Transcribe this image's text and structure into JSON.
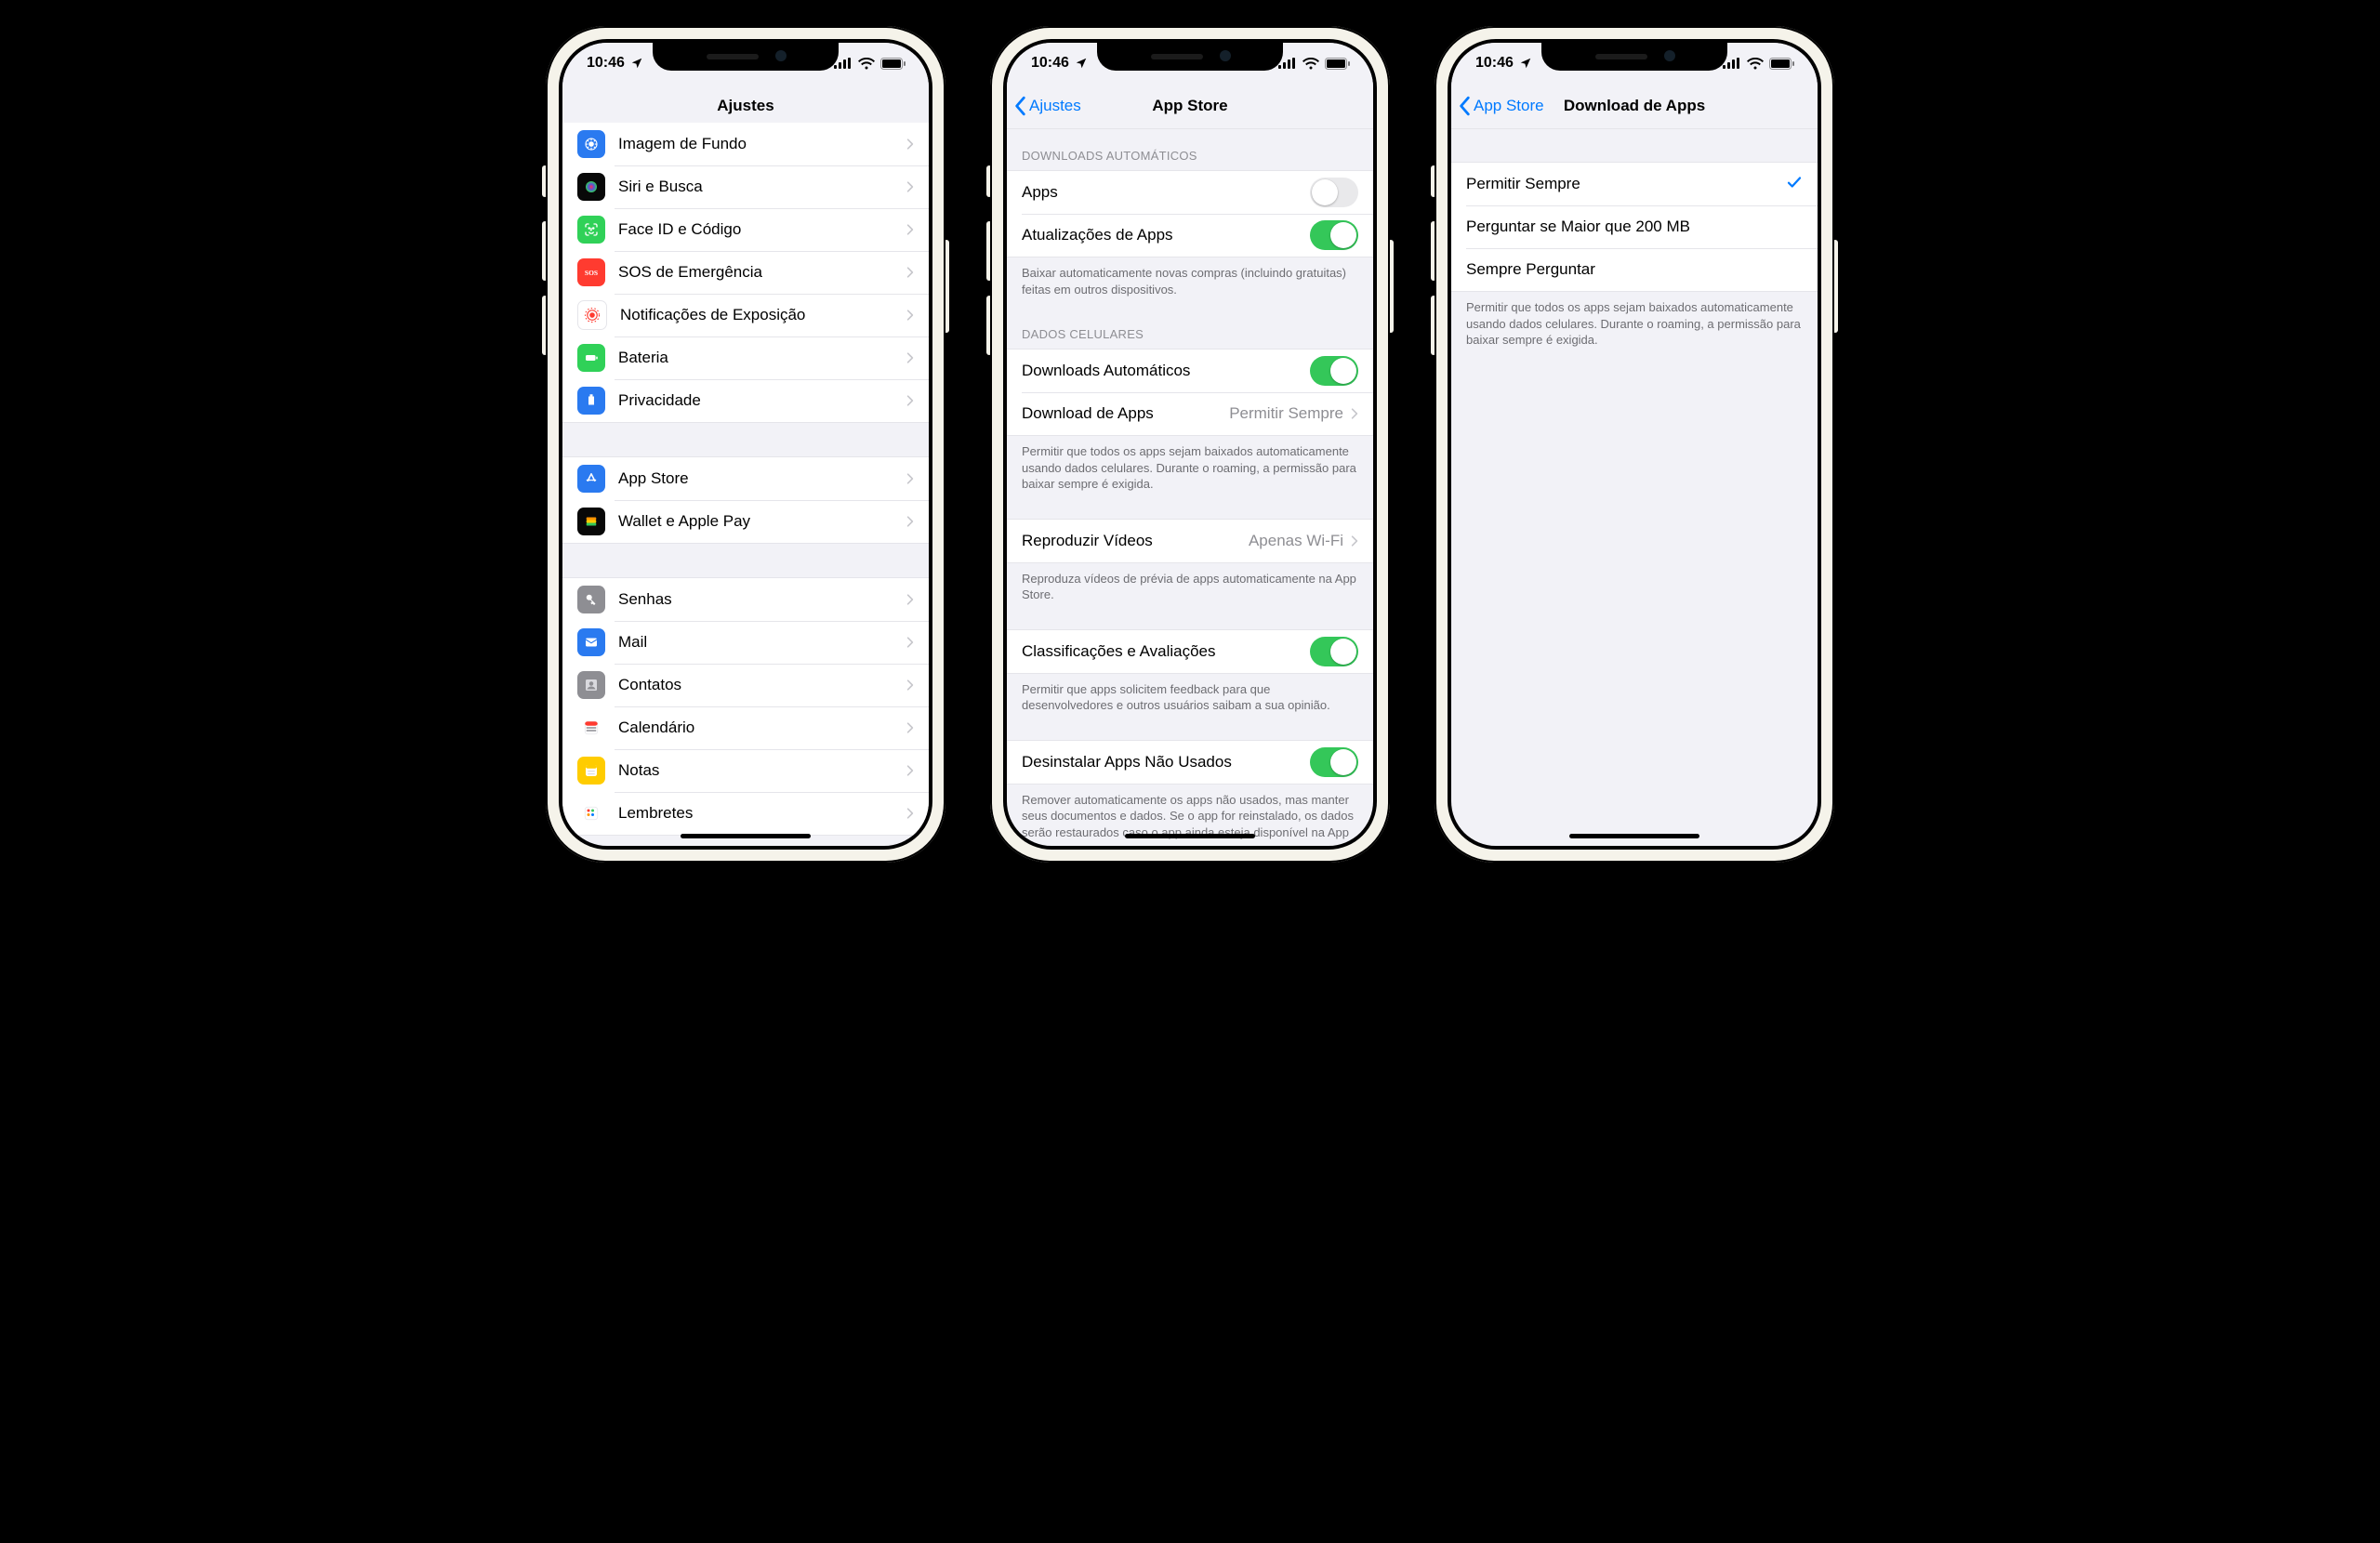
{
  "status": {
    "time": "10:46"
  },
  "phone1": {
    "title": "Ajustes",
    "groups": [
      {
        "items": [
          {
            "label": "Imagem de Fundo",
            "icon": "wallpaper"
          },
          {
            "label": "Siri e Busca",
            "icon": "siri"
          },
          {
            "label": "Face ID e Código",
            "icon": "faceid"
          },
          {
            "label": "SOS de Emergência",
            "icon": "sos"
          },
          {
            "label": "Notificações de Exposição",
            "icon": "exposure"
          },
          {
            "label": "Bateria",
            "icon": "battery"
          },
          {
            "label": "Privacidade",
            "icon": "privacy"
          }
        ]
      },
      {
        "items": [
          {
            "label": "App Store",
            "icon": "appstore"
          },
          {
            "label": "Wallet e Apple Pay",
            "icon": "wallet"
          }
        ]
      },
      {
        "items": [
          {
            "label": "Senhas",
            "icon": "passwords"
          },
          {
            "label": "Mail",
            "icon": "mail"
          },
          {
            "label": "Contatos",
            "icon": "contacts"
          },
          {
            "label": "Calendário",
            "icon": "calendar"
          },
          {
            "label": "Notas",
            "icon": "notes"
          },
          {
            "label": "Lembretes",
            "icon": "reminders"
          }
        ]
      }
    ]
  },
  "phone2": {
    "back": "Ajustes",
    "title": "App Store",
    "sections": [
      {
        "header": "DOWNLOADS AUTOMÁTICOS",
        "rows": [
          {
            "label": "Apps",
            "toggle": false
          },
          {
            "label": "Atualizações de Apps",
            "toggle": true
          }
        ],
        "footer": "Baixar automaticamente novas compras (incluindo gratuitas) feitas em outros dispositivos."
      },
      {
        "header": "DADOS CELULARES",
        "rows": [
          {
            "label": "Downloads Automáticos",
            "toggle": true
          },
          {
            "label": "Download de Apps",
            "detail": "Permitir Sempre",
            "nav": true
          }
        ],
        "footer": "Permitir que todos os apps sejam baixados automaticamente usando dados celulares. Durante o roaming, a permissão para baixar sempre é exigida."
      },
      {
        "rows": [
          {
            "label": "Reproduzir Vídeos",
            "detail": "Apenas Wi-Fi",
            "nav": true
          }
        ],
        "footer": "Reproduza vídeos de prévia de apps automaticamente na App Store."
      },
      {
        "rows": [
          {
            "label": "Classificações e Avaliações",
            "toggle": true
          }
        ],
        "footer": "Permitir que apps solicitem feedback para que desenvolvedores e outros usuários saibam a sua opinião."
      },
      {
        "rows": [
          {
            "label": "Desinstalar Apps Não Usados",
            "toggle": true
          }
        ],
        "footer": "Remover automaticamente os apps não usados, mas manter seus documentos e dados. Se o app for reinstalado, os dados serão restaurados caso o app ainda esteja disponível na App Store."
      }
    ]
  },
  "phone3": {
    "back": "App Store",
    "title": "Download de Apps",
    "options": [
      {
        "label": "Permitir Sempre",
        "selected": true
      },
      {
        "label": "Perguntar se Maior que 200 MB",
        "selected": false
      },
      {
        "label": "Sempre Perguntar",
        "selected": false
      }
    ],
    "footer": "Permitir que todos os apps sejam baixados automaticamente usando dados celulares. Durante o roaming, a permissão para baixar sempre é exigida."
  }
}
